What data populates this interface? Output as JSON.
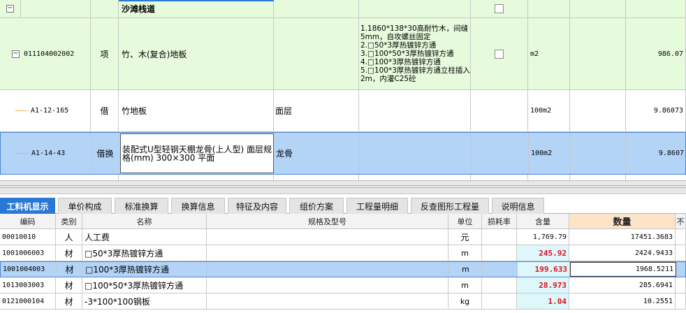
{
  "upper": {
    "section_title": "沙滩栈道",
    "rows": [
      {
        "code": "011104002002",
        "category": "项",
        "name": "竹、木(复合)地板",
        "spec": "",
        "feature": "1.1860*138*30高耐竹木，间缝5mm，自攻螺丝固定\n2.□50*3厚热镀锌方通\n3.□100*50*3厚热镀锌方通\n4.□100*3厚热镀锌方通\n5.□100*3厚热镀锌方通立柱插入2m，内灌C25砼",
        "unit": "m2",
        "quantity": "986.07"
      },
      {
        "code": "A1-12-165",
        "category": "借",
        "name": "竹地板",
        "spec": "面层",
        "feature": "",
        "unit": "100m2",
        "quantity": "9.86073"
      },
      {
        "code": "A1-14-43",
        "category": "借换",
        "name": "装配式U型轻钢天棚龙骨(上人型) 面层规格(mm) 300×300 平面",
        "spec": "龙骨",
        "feature": "",
        "unit": "100m2",
        "quantity": "9.8607"
      }
    ]
  },
  "tabs": [
    {
      "label": "工料机显示",
      "active": true
    },
    {
      "label": "单价构成",
      "active": false
    },
    {
      "label": "标准换算",
      "active": false
    },
    {
      "label": "换算信息",
      "active": false
    },
    {
      "label": "特征及内容",
      "active": false
    },
    {
      "label": "组价方案",
      "active": false
    },
    {
      "label": "工程量明细",
      "active": false
    },
    {
      "label": "反查图形工程量",
      "active": false
    },
    {
      "label": "说明信息",
      "active": false
    }
  ],
  "lower": {
    "headers": {
      "code": "编码",
      "type": "类别",
      "name": "名称",
      "spec": "规格及型号",
      "unit": "单位",
      "loss": "损耗率",
      "content": "含量",
      "quantity": "数量",
      "extra": "不"
    },
    "rows": [
      {
        "code": "00010010",
        "type": "人",
        "name": "人工费",
        "spec": "",
        "unit": "元",
        "loss": "",
        "content": "1,769.79",
        "content_highlight": false,
        "quantity": "17451.3683"
      },
      {
        "code": "1001006003",
        "type": "材",
        "name": "□50*3厚热镀锌方通",
        "spec": "",
        "unit": "m",
        "loss": "",
        "content": "245.92",
        "content_highlight": true,
        "quantity": "2424.9433"
      },
      {
        "code": "1001004003",
        "type": "材",
        "name": "□100*3厚热镀锌方通",
        "spec": "",
        "unit": "m",
        "loss": "",
        "content": "199.633",
        "content_highlight": true,
        "quantity": "1968.5211"
      },
      {
        "code": "1013003003",
        "type": "材",
        "name": "□100*50*3厚热镀锌方通",
        "spec": "",
        "unit": "m",
        "loss": "",
        "content": "28.973",
        "content_highlight": true,
        "quantity": "285.6941"
      },
      {
        "code": "0121000104",
        "type": "材",
        "name": "-3*100*100钢板",
        "spec": "",
        "unit": "kg",
        "loss": "",
        "content": "1.04",
        "content_highlight": true,
        "quantity": "10.2551"
      }
    ]
  },
  "colors": {
    "item_row": "#e6fadc",
    "selected_row": "#b3d3f7",
    "tab_active": "#2a78d6",
    "highlight_text": "#e0101e"
  }
}
